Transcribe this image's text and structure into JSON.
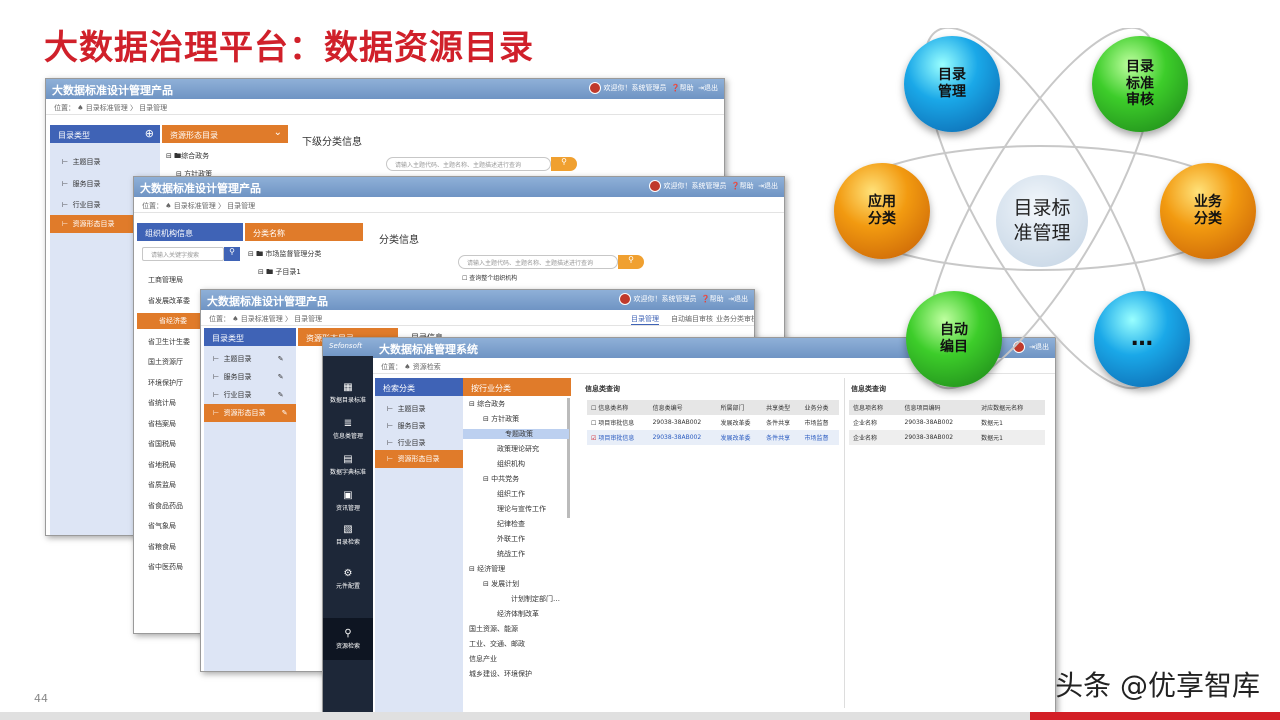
{
  "slide": {
    "title": "大数据治理平台：数据资源目录",
    "page_number": "44",
    "watermark": "头条 @优享智库"
  },
  "w1": {
    "title": "大数据标准设计管理产品",
    "user": "欢迎你！系统管理员",
    "help": "帮助",
    "exit": "退出",
    "breadcrumb": "位置： ♠ 目录标准管理 〉 目录管理",
    "h1": "目录类型",
    "h2": "资源形态目录",
    "items": [
      "主题目录",
      "服务目录",
      "行业目录",
      "资源形态目录"
    ],
    "tree1": "⊟ 🖿综合政务",
    "tree2": "⊟ 方针政策",
    "panel": "下级分类信息",
    "search": "请输入主题代码、主题名称、主题描述进行查询"
  },
  "w2": {
    "title": "大数据标准设计管理产品",
    "user": "欢迎你！系统管理员",
    "help": "帮助",
    "exit": "退出",
    "breadcrumb": "位置： ♠ 目录标准管理 〉 目录管理",
    "h1": "组织机构信息",
    "h2": "分类名称",
    "search_left": "请输入关键字搜索",
    "tree1": "⊟ 🖿 市场监督管理分类",
    "tree2": "⊟ 🖿 子目录1",
    "panel": "分类信息",
    "search": "请输入主题代码、主题名称、主题描述进行查询",
    "check": "查询整个组织机构",
    "orgs": [
      "工商管理局",
      "省发展改革委",
      "省经济委",
      "省卫生计生委",
      "国土资源厅",
      "环境保护厅",
      "省统计局",
      "省档案局",
      "省国税局",
      "省地税局",
      "省质监局",
      "省食品药品",
      "省气象局",
      "省粮食局",
      "省中医药局"
    ]
  },
  "w3": {
    "title": "大数据标准设计管理产品",
    "user": "欢迎你！系统管理员",
    "help": "帮助",
    "exit": "退出",
    "breadcrumb": "位置： ♠ 目录标准管理 〉 目录管理",
    "tabs": [
      "目录管理",
      "自动编目审核",
      "业务分类审核"
    ],
    "h1": "目录类型",
    "h2": "资源形态目录",
    "items": [
      "主题目录",
      "服务目录",
      "行业目录",
      "资源形态目录"
    ],
    "panel": "目录信息"
  },
  "w4": {
    "title": "大数据标准管理系统",
    "logo": "Sefonsoft",
    "exit": "退出",
    "breadcrumb": "位置： ♠ 资源检索",
    "dock": [
      "数据目录标准",
      "信息类管理",
      "数据字典标准",
      "资讯管理",
      "目录检索",
      "元件配置",
      "资源检索"
    ],
    "h1": "检索分类",
    "h2": "按行业分类",
    "items": [
      "主题目录",
      "服务目录",
      "行业目录",
      "资源形态目录"
    ],
    "tree": [
      "⊟ 综合政务",
      "⊟ 方针政策",
      "专题政策",
      "政策理论研究",
      "组织机构",
      "⊟ 中共党务",
      "组织工作",
      "理论与宣传工作",
      "纪律检查",
      "外联工作",
      "统战工作",
      "⊟ 经济管理",
      "⊟ 发展计划",
      "计划制定部门…",
      "经济体制改革",
      "国土资源、能源",
      "工业、交通、邮政",
      "信息产业",
      "城乡建设、环境保护"
    ],
    "p1": "信息类查询",
    "cols1": [
      "信息类名称",
      "信息类编号",
      "所属部门",
      "共享类型",
      "业务分类"
    ],
    "rows1": [
      [
        "项目审批信息",
        "29038-38AB002",
        "发展改革委",
        "条件共享",
        "市场监督"
      ],
      [
        "项目审批信息",
        "29038-38AB002",
        "发展改革委",
        "条件共享",
        "市场监督"
      ]
    ],
    "p2": "信息类查询",
    "cols2": [
      "信息项名称",
      "信息项目编码",
      "对应数据元名称"
    ],
    "rows2": [
      [
        "企业名称",
        "29038-38AB002",
        "数据元1"
      ],
      [
        "企业名称",
        "29038-38AB002",
        "数据元1"
      ]
    ]
  },
  "diagram": {
    "center": "目录标\n准管理",
    "nodes": [
      "目录\n管理",
      "目录\n标准\n审核",
      "应用\n分类",
      "业务\n分类",
      "自动\n编目",
      "…"
    ]
  }
}
